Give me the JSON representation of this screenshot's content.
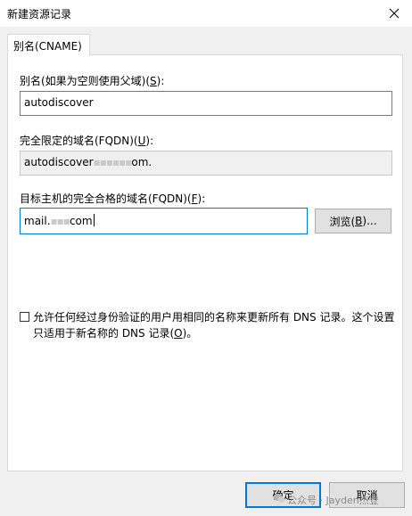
{
  "window": {
    "title": "新建资源记录"
  },
  "tab": {
    "label": "别名(CNAME)"
  },
  "alias": {
    "label_prefix": "别名(如果为空则使用父域)(",
    "label_key": "S",
    "label_suffix": "):",
    "value": "autodiscover"
  },
  "fqdn": {
    "label_prefix": "完全限定的域名(FQDN)(",
    "label_key": "U",
    "label_suffix": "):",
    "value_start": "autodiscover",
    "value_redacted": "▪▪▪▪▪▪",
    "value_end": "om."
  },
  "target": {
    "label_prefix": "目标主机的完全合格的域名(FQDN)(",
    "label_key": "F",
    "label_suffix": "):",
    "value_start": "mail.",
    "value_redacted": "▪▪▪",
    "value_end": "com"
  },
  "browse_button": {
    "label_prefix": "浏览(",
    "label_key": "B",
    "label_suffix": ")..."
  },
  "checkbox": {
    "checked": false,
    "text_main": "允许任何经过身份验证的用户用相同的名称来更新所有 DNS 记录。这个设置只适用于新名称的 DNS 记录(",
    "text_key": "O",
    "text_suffix": ")。"
  },
  "buttons": {
    "ok": "确定",
    "cancel": "取消"
  },
  "watermark": {
    "text": "公众号 · Jayden杰登"
  },
  "colors": {
    "accent": "#0078d7",
    "window_bg": "#f0f0f0",
    "panel_bg": "#ffffff"
  },
  "icons": {
    "close": "close-icon",
    "wechat": "wechat-icon"
  }
}
